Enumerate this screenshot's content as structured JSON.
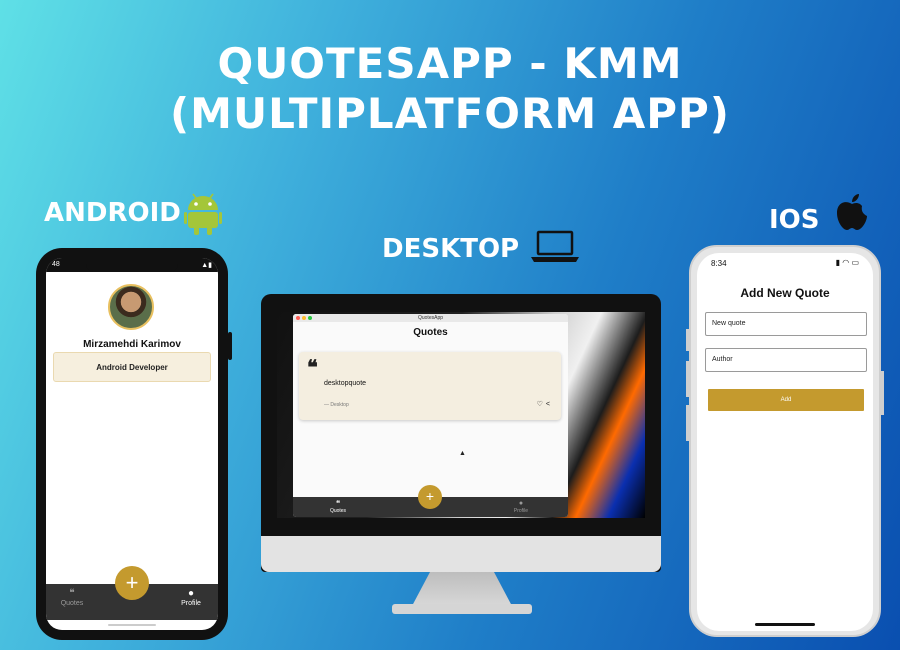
{
  "title": {
    "line1": "QUOTESAPP - KMM",
    "line2": "(MULTIPLATFORM APP)"
  },
  "platforms": {
    "android": "ANDROID",
    "desktop": "DESKTOP",
    "ios": "IOS"
  },
  "android_app": {
    "status_left": "48",
    "profile_name": "Mirzamehdi Karimov",
    "profile_role": "Android Developer",
    "fab_label": "+",
    "nav": [
      {
        "label": "Quotes",
        "icon": "quote-icon",
        "active": false
      },
      {
        "label": "Profile",
        "icon": "person-icon",
        "active": true
      }
    ]
  },
  "desktop_app": {
    "window_title": "QuotesApp",
    "screen_title": "Quotes",
    "quote_text": "desktopquote",
    "quote_author": "— Desktop",
    "fab_label": "+",
    "nav": [
      {
        "label": "Quotes",
        "icon": "quote-icon",
        "active": true
      },
      {
        "label": "Profile",
        "icon": "person-icon",
        "active": false
      }
    ]
  },
  "ios_app": {
    "time": "8:34",
    "heading": "Add New Quote",
    "quote_field": "New quote",
    "author_field": "Author",
    "add_button": "Add"
  },
  "colors": {
    "accent": "#c49a2e",
    "card": "#f4eee0",
    "nav_bg": "#333333"
  }
}
